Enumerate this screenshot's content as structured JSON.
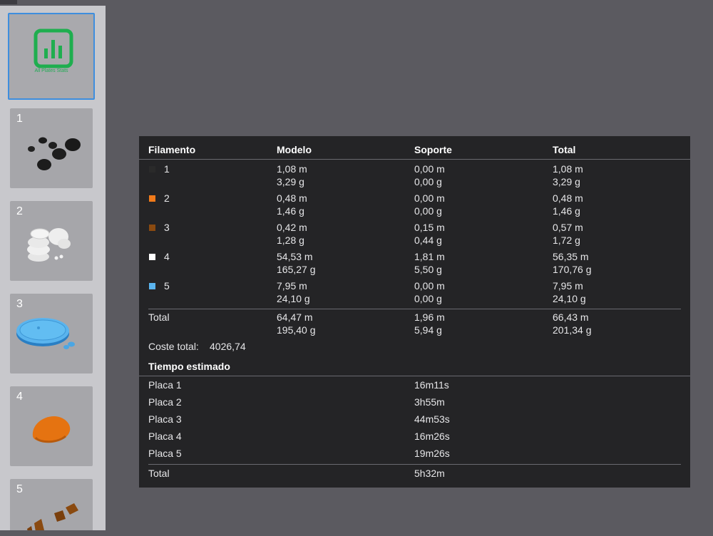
{
  "sidebar": {
    "stats_label": "All Plates Stats",
    "plates": [
      {
        "number": "1"
      },
      {
        "number": "2"
      },
      {
        "number": "3"
      },
      {
        "number": "4"
      },
      {
        "number": "5"
      }
    ]
  },
  "stats": {
    "headers": {
      "filament": "Filamento",
      "model": "Modelo",
      "support": "Soporte",
      "total": "Total"
    },
    "filaments": [
      {
        "id": "1",
        "color": "#2a2a2a",
        "model_len": "1,08 m",
        "model_wt": "3,29 g",
        "support_len": "0,00 m",
        "support_wt": "0,00 g",
        "total_len": "1,08 m",
        "total_wt": "3,29 g"
      },
      {
        "id": "2",
        "color": "#f07a1a",
        "model_len": "0,48 m",
        "model_wt": "1,46 g",
        "support_len": "0,00 m",
        "support_wt": "0,00 g",
        "total_len": "0,48 m",
        "total_wt": "1,46 g"
      },
      {
        "id": "3",
        "color": "#8a4a10",
        "model_len": "0,42 m",
        "model_wt": "1,28 g",
        "support_len": "0,15 m",
        "support_wt": "0,44 g",
        "total_len": "0,57 m",
        "total_wt": "1,72 g"
      },
      {
        "id": "4",
        "color": "#ffffff",
        "model_len": "54,53 m",
        "model_wt": "165,27 g",
        "support_len": "1,81 m",
        "support_wt": "5,50 g",
        "total_len": "56,35 m",
        "total_wt": "170,76 g"
      },
      {
        "id": "5",
        "color": "#5ab4ee",
        "model_len": "7,95 m",
        "model_wt": "24,10 g",
        "support_len": "0,00 m",
        "support_wt": "0,00 g",
        "total_len": "7,95 m",
        "total_wt": "24,10 g"
      }
    ],
    "totals": {
      "label": "Total",
      "model_len": "64,47 m",
      "model_wt": "195,40 g",
      "support_len": "1,96 m",
      "support_wt": "5,94 g",
      "total_len": "66,43 m",
      "total_wt": "201,34 g"
    },
    "cost_label": "Coste total:",
    "cost_value": "4026,74",
    "time_title": "Tiempo estimado",
    "times": [
      {
        "label": "Placa 1",
        "value": "16m11s"
      },
      {
        "label": "Placa 2",
        "value": "3h55m"
      },
      {
        "label": "Placa 3",
        "value": "44m53s"
      },
      {
        "label": "Placa 4",
        "value": "16m26s"
      },
      {
        "label": "Placa 5",
        "value": "19m26s"
      }
    ],
    "time_total_label": "Total",
    "time_total_value": "5h32m"
  }
}
